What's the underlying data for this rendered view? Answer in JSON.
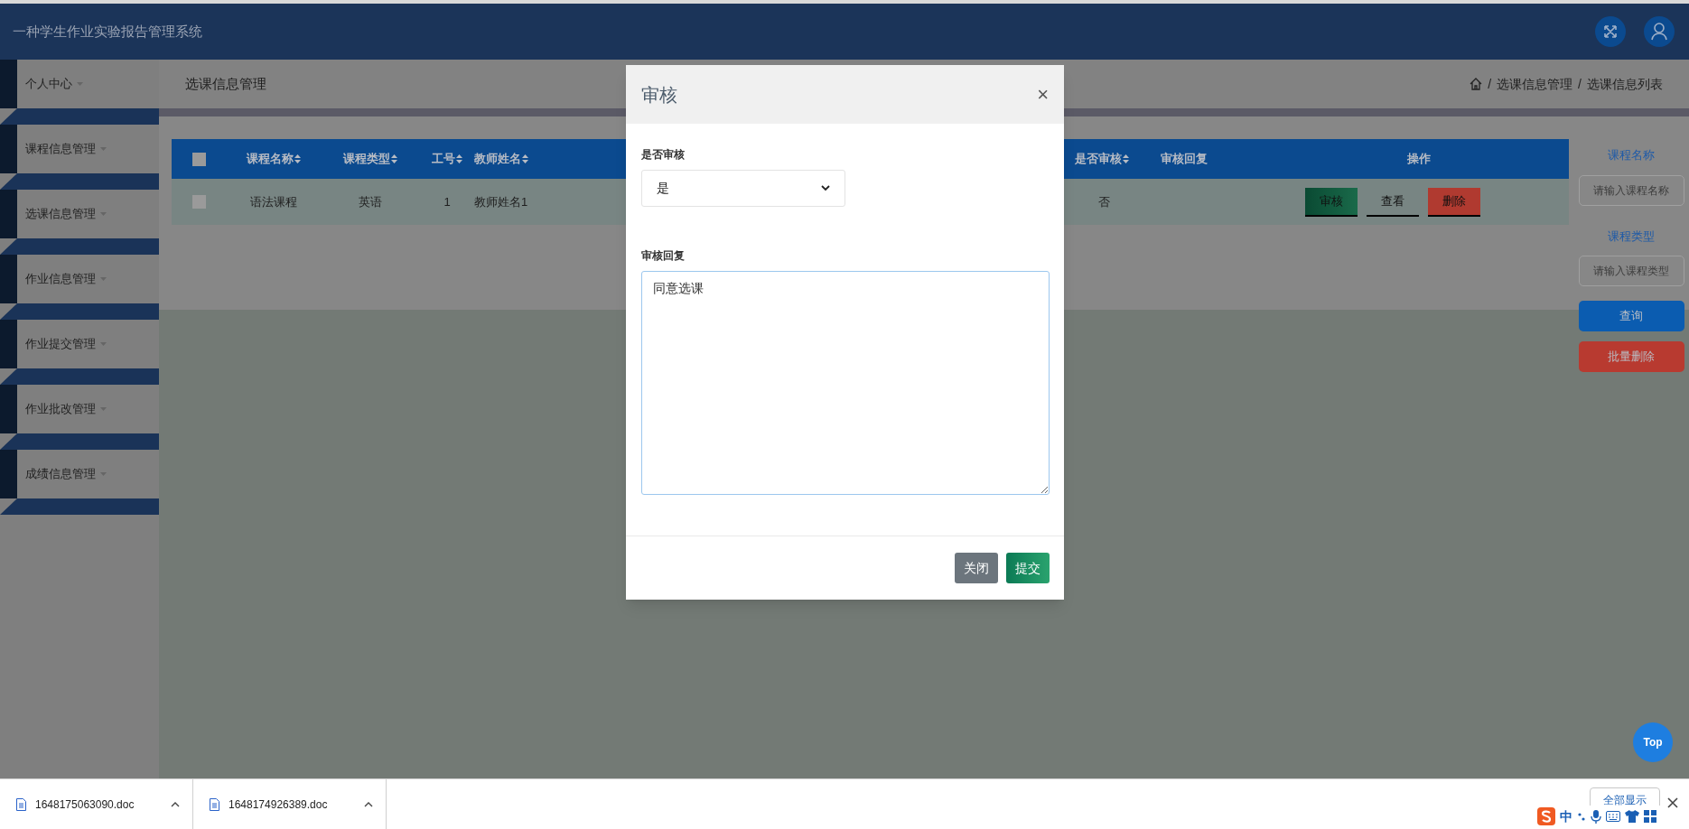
{
  "app": {
    "title": "一种学生作业实验报告管理系统"
  },
  "sidebar": {
    "items": [
      {
        "label": "个人中心"
      },
      {
        "label": "课程信息管理"
      },
      {
        "label": "选课信息管理"
      },
      {
        "label": "作业信息管理"
      },
      {
        "label": "作业提交管理"
      },
      {
        "label": "作业批改管理"
      },
      {
        "label": "成绩信息管理"
      }
    ]
  },
  "page": {
    "title": "选课信息管理",
    "breadcrumb": [
      "选课信息管理",
      "选课信息列表"
    ],
    "breadcrumb_separator": "/"
  },
  "table": {
    "header_checked": false,
    "columns": [
      {
        "label": "课程名称",
        "sortable": true
      },
      {
        "label": "课程类型",
        "sortable": true
      },
      {
        "label": "工号",
        "sortable": true
      },
      {
        "label": "教师姓名",
        "sortable": true
      },
      {
        "label": "是否审核",
        "sortable": true
      },
      {
        "label": "审核回复",
        "sortable": false
      },
      {
        "label": "操作",
        "sortable": false
      }
    ],
    "rows": [
      {
        "checked": false,
        "cells": [
          "语法课程",
          "英语",
          "1",
          "教师姓名1",
          "否"
        ],
        "actions": [
          {
            "label": "审核",
            "kind": "approve"
          },
          {
            "label": "查看",
            "kind": "view"
          },
          {
            "label": "删除",
            "kind": "delete"
          }
        ]
      }
    ]
  },
  "search": {
    "fields": [
      {
        "label": "课程名称",
        "placeholder": "请输入课程名称"
      },
      {
        "label": "课程类型",
        "placeholder": "请输入课程类型"
      }
    ],
    "buttons": [
      {
        "label": "查询",
        "kind": "primary"
      },
      {
        "label": "批量删除",
        "kind": "danger"
      }
    ]
  },
  "modal": {
    "title": "审核",
    "close": "×",
    "fields": [
      {
        "kind": "select",
        "label": "是否审核",
        "value": "是"
      },
      {
        "kind": "textarea",
        "label": "审核回复",
        "value": "同意选课"
      }
    ],
    "buttons": [
      {
        "label": "关闭",
        "kind": "secondary"
      },
      {
        "label": "提交",
        "kind": "primary"
      }
    ]
  },
  "top_button": "Top",
  "downloads": {
    "items": [
      {
        "filename": "1648175063090.doc"
      },
      {
        "filename": "1648174926389.doc"
      }
    ],
    "show_all": "全部显示"
  },
  "ime": {
    "mode": "中"
  }
}
